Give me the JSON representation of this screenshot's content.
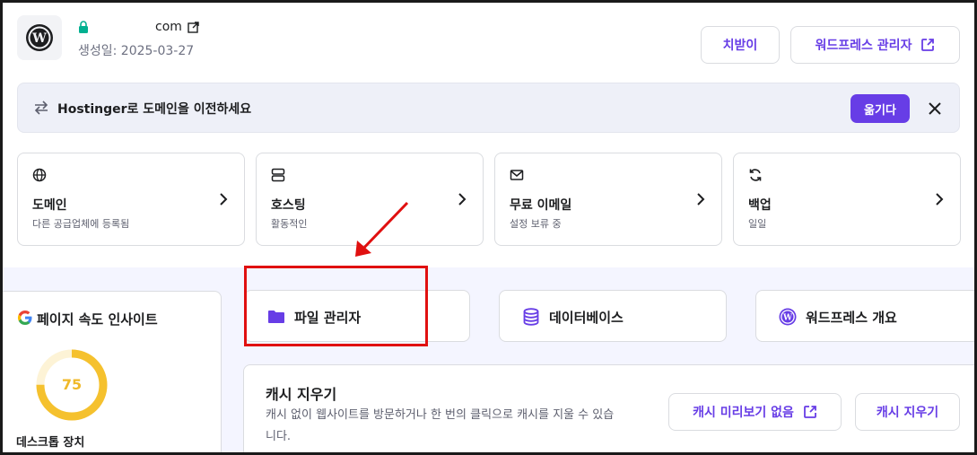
{
  "site": {
    "domain_suffix": "com",
    "created_label": "생성일: 2025-03-27"
  },
  "header_buttons": {
    "change": "치받이",
    "wp_admin": "워드프레스 관리자"
  },
  "banner": {
    "text": "Hostinger로 도메인을 이전하세요",
    "action": "옮기다"
  },
  "cards": [
    {
      "title": "도메인",
      "subtitle": "다른 공급업체에 등록됨",
      "icon": "globe-icon"
    },
    {
      "title": "호스팅",
      "subtitle": "활동적인",
      "icon": "server-icon"
    },
    {
      "title": "무료 이메일",
      "subtitle": "설정 보류 중",
      "icon": "mail-icon"
    },
    {
      "title": "백업",
      "subtitle": "일일",
      "icon": "refresh-icon"
    }
  ],
  "speed": {
    "title": "페이지 속도 인사이트",
    "score": "75",
    "score_fraction": 0.75,
    "device": "데스크톱 장치"
  },
  "quick": [
    {
      "label": "파일 관리자",
      "icon": "folder-icon"
    },
    {
      "label": "데이터베이스",
      "icon": "database-icon"
    },
    {
      "label": "워드프레스 개요",
      "icon": "wordpress-icon"
    }
  ],
  "cache": {
    "title": "캐시 지우기",
    "description": "캐시 없이 웹사이트를 방문하거나 한 번의 클릭으로 캐시를 지울 수 있습니다.",
    "preview_button": "캐시 미리보기 없음",
    "clear_button": "캐시 지우기"
  },
  "colors": {
    "accent": "#673de6",
    "highlight": "#e01010",
    "gauge": "#f5c12e",
    "bottom_bg": "#f4f5ff"
  }
}
